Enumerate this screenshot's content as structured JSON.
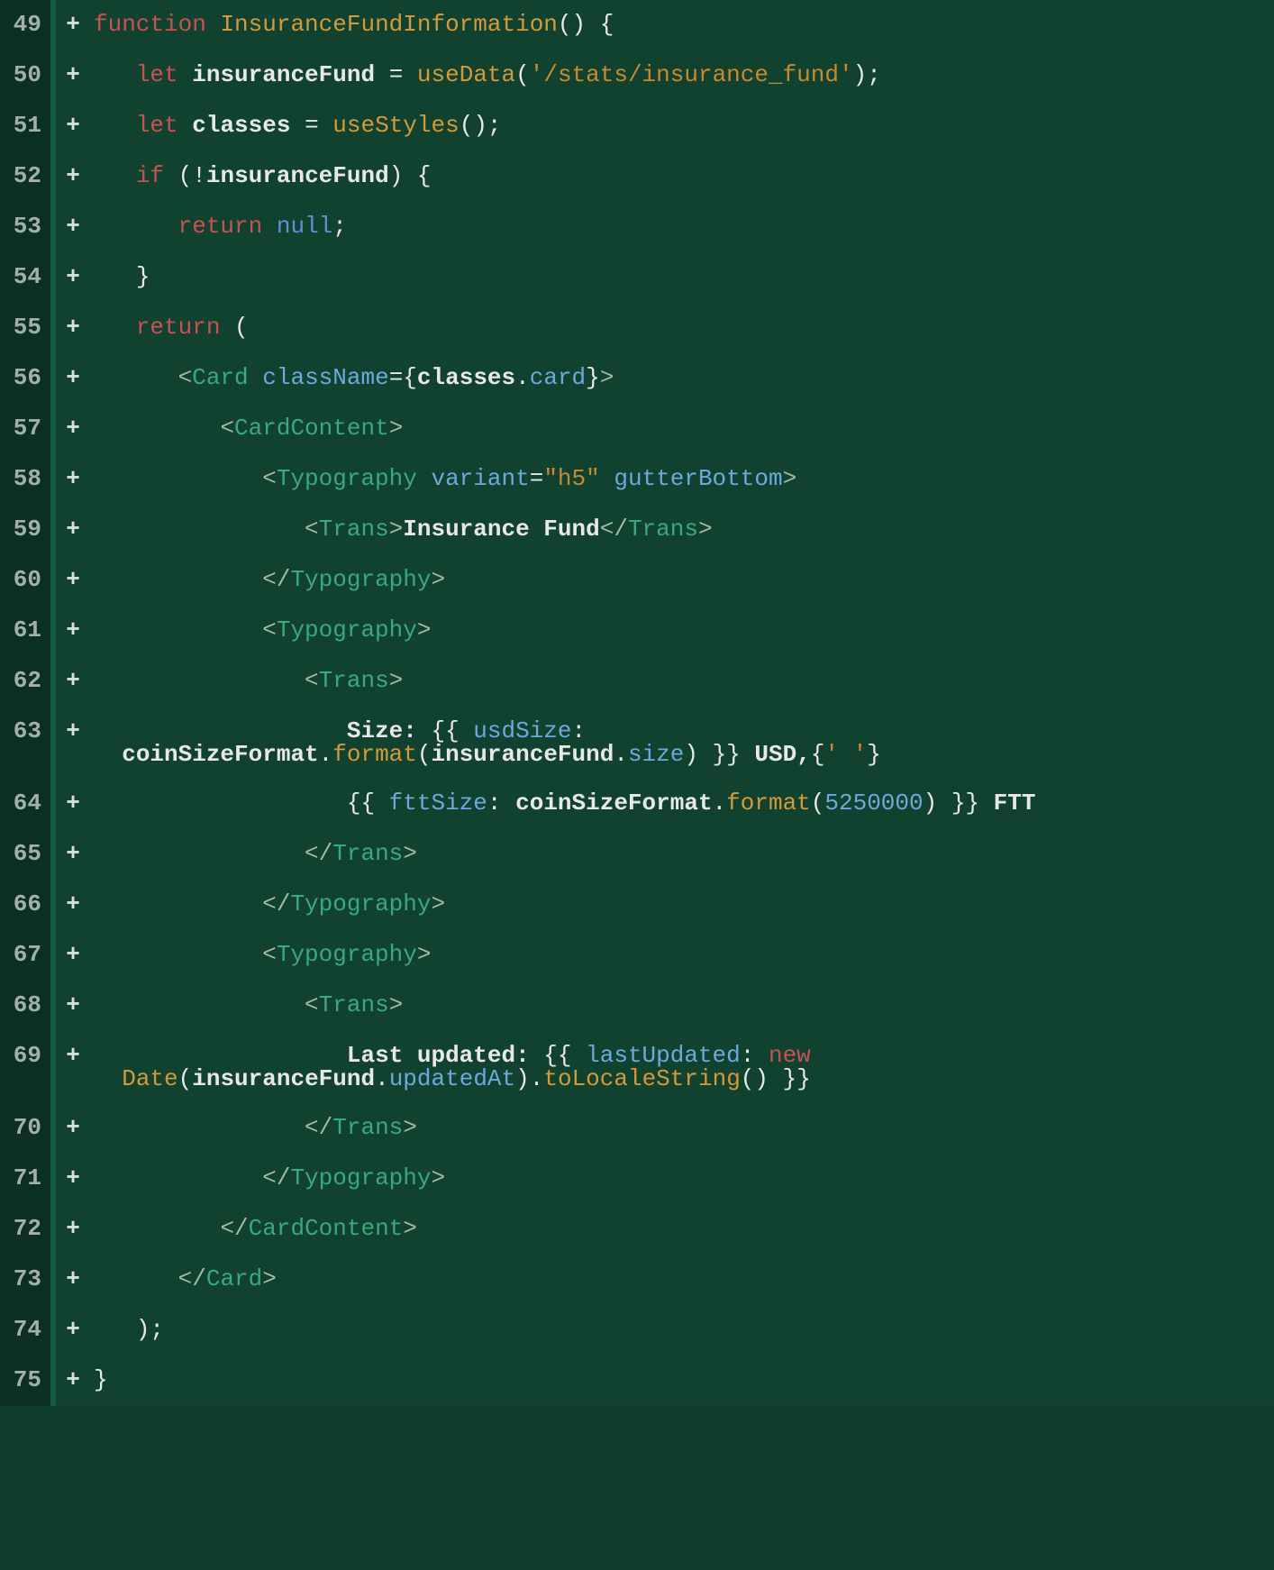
{
  "diff": {
    "lines": [
      {
        "ln": 49,
        "sign": "+",
        "indent": 0,
        "tokens": [
          {
            "t": "kw",
            "v": "function"
          },
          {
            "t": "sp",
            "v": " "
          },
          {
            "t": "fn",
            "v": "InsuranceFundInformation"
          },
          {
            "t": "punct",
            "v": "() {"
          }
        ]
      },
      {
        "ln": 50,
        "sign": "+",
        "indent": 1,
        "tokens": [
          {
            "t": "kw",
            "v": "let"
          },
          {
            "t": "sp",
            "v": " "
          },
          {
            "t": "id",
            "v": "insuranceFund"
          },
          {
            "t": "sp",
            "v": " "
          },
          {
            "t": "punct",
            "v": "="
          },
          {
            "t": "sp",
            "v": " "
          },
          {
            "t": "fn",
            "v": "useData"
          },
          {
            "t": "punct",
            "v": "("
          },
          {
            "t": "str",
            "v": "'/stats/insurance_fund'"
          },
          {
            "t": "punct",
            "v": ");"
          }
        ]
      },
      {
        "ln": 51,
        "sign": "+",
        "indent": 1,
        "tokens": [
          {
            "t": "kw",
            "v": "let"
          },
          {
            "t": "sp",
            "v": " "
          },
          {
            "t": "id",
            "v": "classes"
          },
          {
            "t": "sp",
            "v": " "
          },
          {
            "t": "punct",
            "v": "="
          },
          {
            "t": "sp",
            "v": " "
          },
          {
            "t": "fn",
            "v": "useStyles"
          },
          {
            "t": "punct",
            "v": "();"
          }
        ]
      },
      {
        "ln": 52,
        "sign": "+",
        "indent": 1,
        "tokens": [
          {
            "t": "kw",
            "v": "if"
          },
          {
            "t": "sp",
            "v": " "
          },
          {
            "t": "punct",
            "v": "(!"
          },
          {
            "t": "id",
            "v": "insuranceFund"
          },
          {
            "t": "punct",
            "v": ") {"
          }
        ]
      },
      {
        "ln": 53,
        "sign": "+",
        "indent": 2,
        "tokens": [
          {
            "t": "kw",
            "v": "return"
          },
          {
            "t": "sp",
            "v": " "
          },
          {
            "t": "lit",
            "v": "null"
          },
          {
            "t": "punct",
            "v": ";"
          }
        ]
      },
      {
        "ln": 54,
        "sign": "+",
        "indent": 1,
        "tokens": [
          {
            "t": "punct",
            "v": "}"
          }
        ]
      },
      {
        "ln": 55,
        "sign": "+",
        "indent": 1,
        "tokens": [
          {
            "t": "kw",
            "v": "return"
          },
          {
            "t": "sp",
            "v": " "
          },
          {
            "t": "punct",
            "v": "("
          }
        ]
      },
      {
        "ln": 56,
        "sign": "+",
        "indent": 2,
        "tokens": [
          {
            "t": "ang",
            "v": "<"
          },
          {
            "t": "tag",
            "v": "Card"
          },
          {
            "t": "sp",
            "v": " "
          },
          {
            "t": "attr",
            "v": "className"
          },
          {
            "t": "punct",
            "v": "={"
          },
          {
            "t": "id",
            "v": "classes"
          },
          {
            "t": "punct",
            "v": "."
          },
          {
            "t": "prop",
            "v": "card"
          },
          {
            "t": "punct",
            "v": "}"
          },
          {
            "t": "ang",
            "v": ">"
          }
        ]
      },
      {
        "ln": 57,
        "sign": "+",
        "indent": 3,
        "tokens": [
          {
            "t": "ang",
            "v": "<"
          },
          {
            "t": "tag",
            "v": "CardContent"
          },
          {
            "t": "ang",
            "v": ">"
          }
        ]
      },
      {
        "ln": 58,
        "sign": "+",
        "indent": 4,
        "tokens": [
          {
            "t": "ang",
            "v": "<"
          },
          {
            "t": "tag",
            "v": "Typography"
          },
          {
            "t": "sp",
            "v": " "
          },
          {
            "t": "attr",
            "v": "variant"
          },
          {
            "t": "punct",
            "v": "="
          },
          {
            "t": "str",
            "v": "\"h5\""
          },
          {
            "t": "sp",
            "v": " "
          },
          {
            "t": "attr",
            "v": "gutterBottom"
          },
          {
            "t": "ang",
            "v": ">"
          }
        ]
      },
      {
        "ln": 59,
        "sign": "+",
        "indent": 5,
        "tokens": [
          {
            "t": "ang",
            "v": "<"
          },
          {
            "t": "tag",
            "v": "Trans"
          },
          {
            "t": "ang",
            "v": ">"
          },
          {
            "t": "id",
            "v": "Insurance Fund"
          },
          {
            "t": "ang",
            "v": "</"
          },
          {
            "t": "tag",
            "v": "Trans"
          },
          {
            "t": "ang",
            "v": ">"
          }
        ]
      },
      {
        "ln": 60,
        "sign": "+",
        "indent": 4,
        "tokens": [
          {
            "t": "ang",
            "v": "</"
          },
          {
            "t": "tag",
            "v": "Typography"
          },
          {
            "t": "ang",
            "v": ">"
          }
        ]
      },
      {
        "ln": 61,
        "sign": "+",
        "indent": 4,
        "tokens": [
          {
            "t": "ang",
            "v": "<"
          },
          {
            "t": "tag",
            "v": "Typography"
          },
          {
            "t": "ang",
            "v": ">"
          }
        ]
      },
      {
        "ln": 62,
        "sign": "+",
        "indent": 5,
        "tokens": [
          {
            "t": "ang",
            "v": "<"
          },
          {
            "t": "tag",
            "v": "Trans"
          },
          {
            "t": "ang",
            "v": ">"
          }
        ]
      },
      {
        "ln": 63,
        "sign": "+",
        "indent": 6,
        "tokens": [
          {
            "t": "id",
            "v": "Size: "
          },
          {
            "t": "punct",
            "v": "{{ "
          },
          {
            "t": "var",
            "v": "usdSize"
          },
          {
            "t": "punct",
            "v": ":"
          }
        ],
        "wrap": [
          {
            "t": "id",
            "v": "coinSizeFormat"
          },
          {
            "t": "punct",
            "v": "."
          },
          {
            "t": "fn",
            "v": "format"
          },
          {
            "t": "punct",
            "v": "("
          },
          {
            "t": "id",
            "v": "insuranceFund"
          },
          {
            "t": "punct",
            "v": "."
          },
          {
            "t": "prop",
            "v": "size"
          },
          {
            "t": "punct",
            "v": ") }} "
          },
          {
            "t": "id",
            "v": "USD,"
          },
          {
            "t": "punct",
            "v": "{"
          },
          {
            "t": "str",
            "v": "' '"
          },
          {
            "t": "punct",
            "v": "}"
          }
        ]
      },
      {
        "ln": 64,
        "sign": "+",
        "indent": 6,
        "tokens": [
          {
            "t": "punct",
            "v": "{{ "
          },
          {
            "t": "var",
            "v": "fttSize"
          },
          {
            "t": "punct",
            "v": ": "
          },
          {
            "t": "id",
            "v": "coinSizeFormat"
          },
          {
            "t": "punct",
            "v": "."
          },
          {
            "t": "fn",
            "v": "format"
          },
          {
            "t": "punct",
            "v": "("
          },
          {
            "t": "num",
            "v": "5250000"
          },
          {
            "t": "punct",
            "v": ") }} "
          },
          {
            "t": "id",
            "v": "FTT"
          }
        ]
      },
      {
        "ln": 65,
        "sign": "+",
        "indent": 5,
        "tokens": [
          {
            "t": "ang",
            "v": "</"
          },
          {
            "t": "tag",
            "v": "Trans"
          },
          {
            "t": "ang",
            "v": ">"
          }
        ]
      },
      {
        "ln": 66,
        "sign": "+",
        "indent": 4,
        "tokens": [
          {
            "t": "ang",
            "v": "</"
          },
          {
            "t": "tag",
            "v": "Typography"
          },
          {
            "t": "ang",
            "v": ">"
          }
        ]
      },
      {
        "ln": 67,
        "sign": "+",
        "indent": 4,
        "tokens": [
          {
            "t": "ang",
            "v": "<"
          },
          {
            "t": "tag",
            "v": "Typography"
          },
          {
            "t": "ang",
            "v": ">"
          }
        ]
      },
      {
        "ln": 68,
        "sign": "+",
        "indent": 5,
        "tokens": [
          {
            "t": "ang",
            "v": "<"
          },
          {
            "t": "tag",
            "v": "Trans"
          },
          {
            "t": "ang",
            "v": ">"
          }
        ]
      },
      {
        "ln": 69,
        "sign": "+",
        "indent": 6,
        "tokens": [
          {
            "t": "id",
            "v": "Last updated: "
          },
          {
            "t": "punct",
            "v": "{{ "
          },
          {
            "t": "var",
            "v": "lastUpdated"
          },
          {
            "t": "punct",
            "v": ": "
          },
          {
            "t": "kw",
            "v": "new"
          }
        ],
        "wrap": [
          {
            "t": "fn",
            "v": "Date"
          },
          {
            "t": "punct",
            "v": "("
          },
          {
            "t": "id",
            "v": "insuranceFund"
          },
          {
            "t": "punct",
            "v": "."
          },
          {
            "t": "prop",
            "v": "updatedAt"
          },
          {
            "t": "punct",
            "v": ")."
          },
          {
            "t": "fn",
            "v": "toLocaleString"
          },
          {
            "t": "punct",
            "v": "() }}"
          }
        ]
      },
      {
        "ln": 70,
        "sign": "+",
        "indent": 5,
        "tokens": [
          {
            "t": "ang",
            "v": "</"
          },
          {
            "t": "tag",
            "v": "Trans"
          },
          {
            "t": "ang",
            "v": ">"
          }
        ]
      },
      {
        "ln": 71,
        "sign": "+",
        "indent": 4,
        "tokens": [
          {
            "t": "ang",
            "v": "</"
          },
          {
            "t": "tag",
            "v": "Typography"
          },
          {
            "t": "ang",
            "v": ">"
          }
        ]
      },
      {
        "ln": 72,
        "sign": "+",
        "indent": 3,
        "tokens": [
          {
            "t": "ang",
            "v": "</"
          },
          {
            "t": "tag",
            "v": "CardContent"
          },
          {
            "t": "ang",
            "v": ">"
          }
        ]
      },
      {
        "ln": 73,
        "sign": "+",
        "indent": 2,
        "tokens": [
          {
            "t": "ang",
            "v": "</"
          },
          {
            "t": "tag",
            "v": "Card"
          },
          {
            "t": "ang",
            "v": ">"
          }
        ]
      },
      {
        "ln": 74,
        "sign": "+",
        "indent": 1,
        "tokens": [
          {
            "t": "punct",
            "v": ");"
          }
        ]
      },
      {
        "ln": 75,
        "sign": "+",
        "indent": 0,
        "tokens": [
          {
            "t": "punct",
            "v": "}"
          }
        ]
      }
    ]
  }
}
